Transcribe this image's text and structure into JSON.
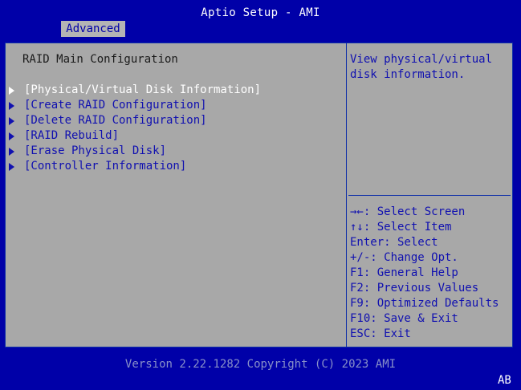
{
  "header": {
    "title": "Aptio Setup - AMI",
    "active_tab": "Advanced"
  },
  "main": {
    "heading": "RAID Main Configuration",
    "items": [
      {
        "label": "[Physical/Virtual Disk Information]",
        "selected": true
      },
      {
        "label": "[Create RAID Configuration]",
        "selected": false
      },
      {
        "label": "[Delete RAID Configuration]",
        "selected": false
      },
      {
        "label": "[RAID Rebuild]",
        "selected": false
      },
      {
        "label": "[Erase Physical Disk]",
        "selected": false
      },
      {
        "label": "[Controller Information]",
        "selected": false
      }
    ]
  },
  "help": {
    "description": "View physical/virtual\ndisk information.",
    "keys": [
      "→←: Select Screen",
      "↑↓: Select Item",
      "Enter: Select",
      "+/-: Change Opt.",
      "F1: General Help",
      "F2: Previous Values",
      "F9: Optimized Defaults",
      "F10: Save & Exit",
      "ESC: Exit"
    ]
  },
  "footer": {
    "version": "Version 2.22.1282 Copyright (C) 2023 AMI",
    "corner_label": "AB"
  },
  "colors": {
    "background": "#0000a8",
    "panel": "#a8a8a8",
    "text_blue": "#1010b0",
    "selected_text": "#ffffff"
  }
}
